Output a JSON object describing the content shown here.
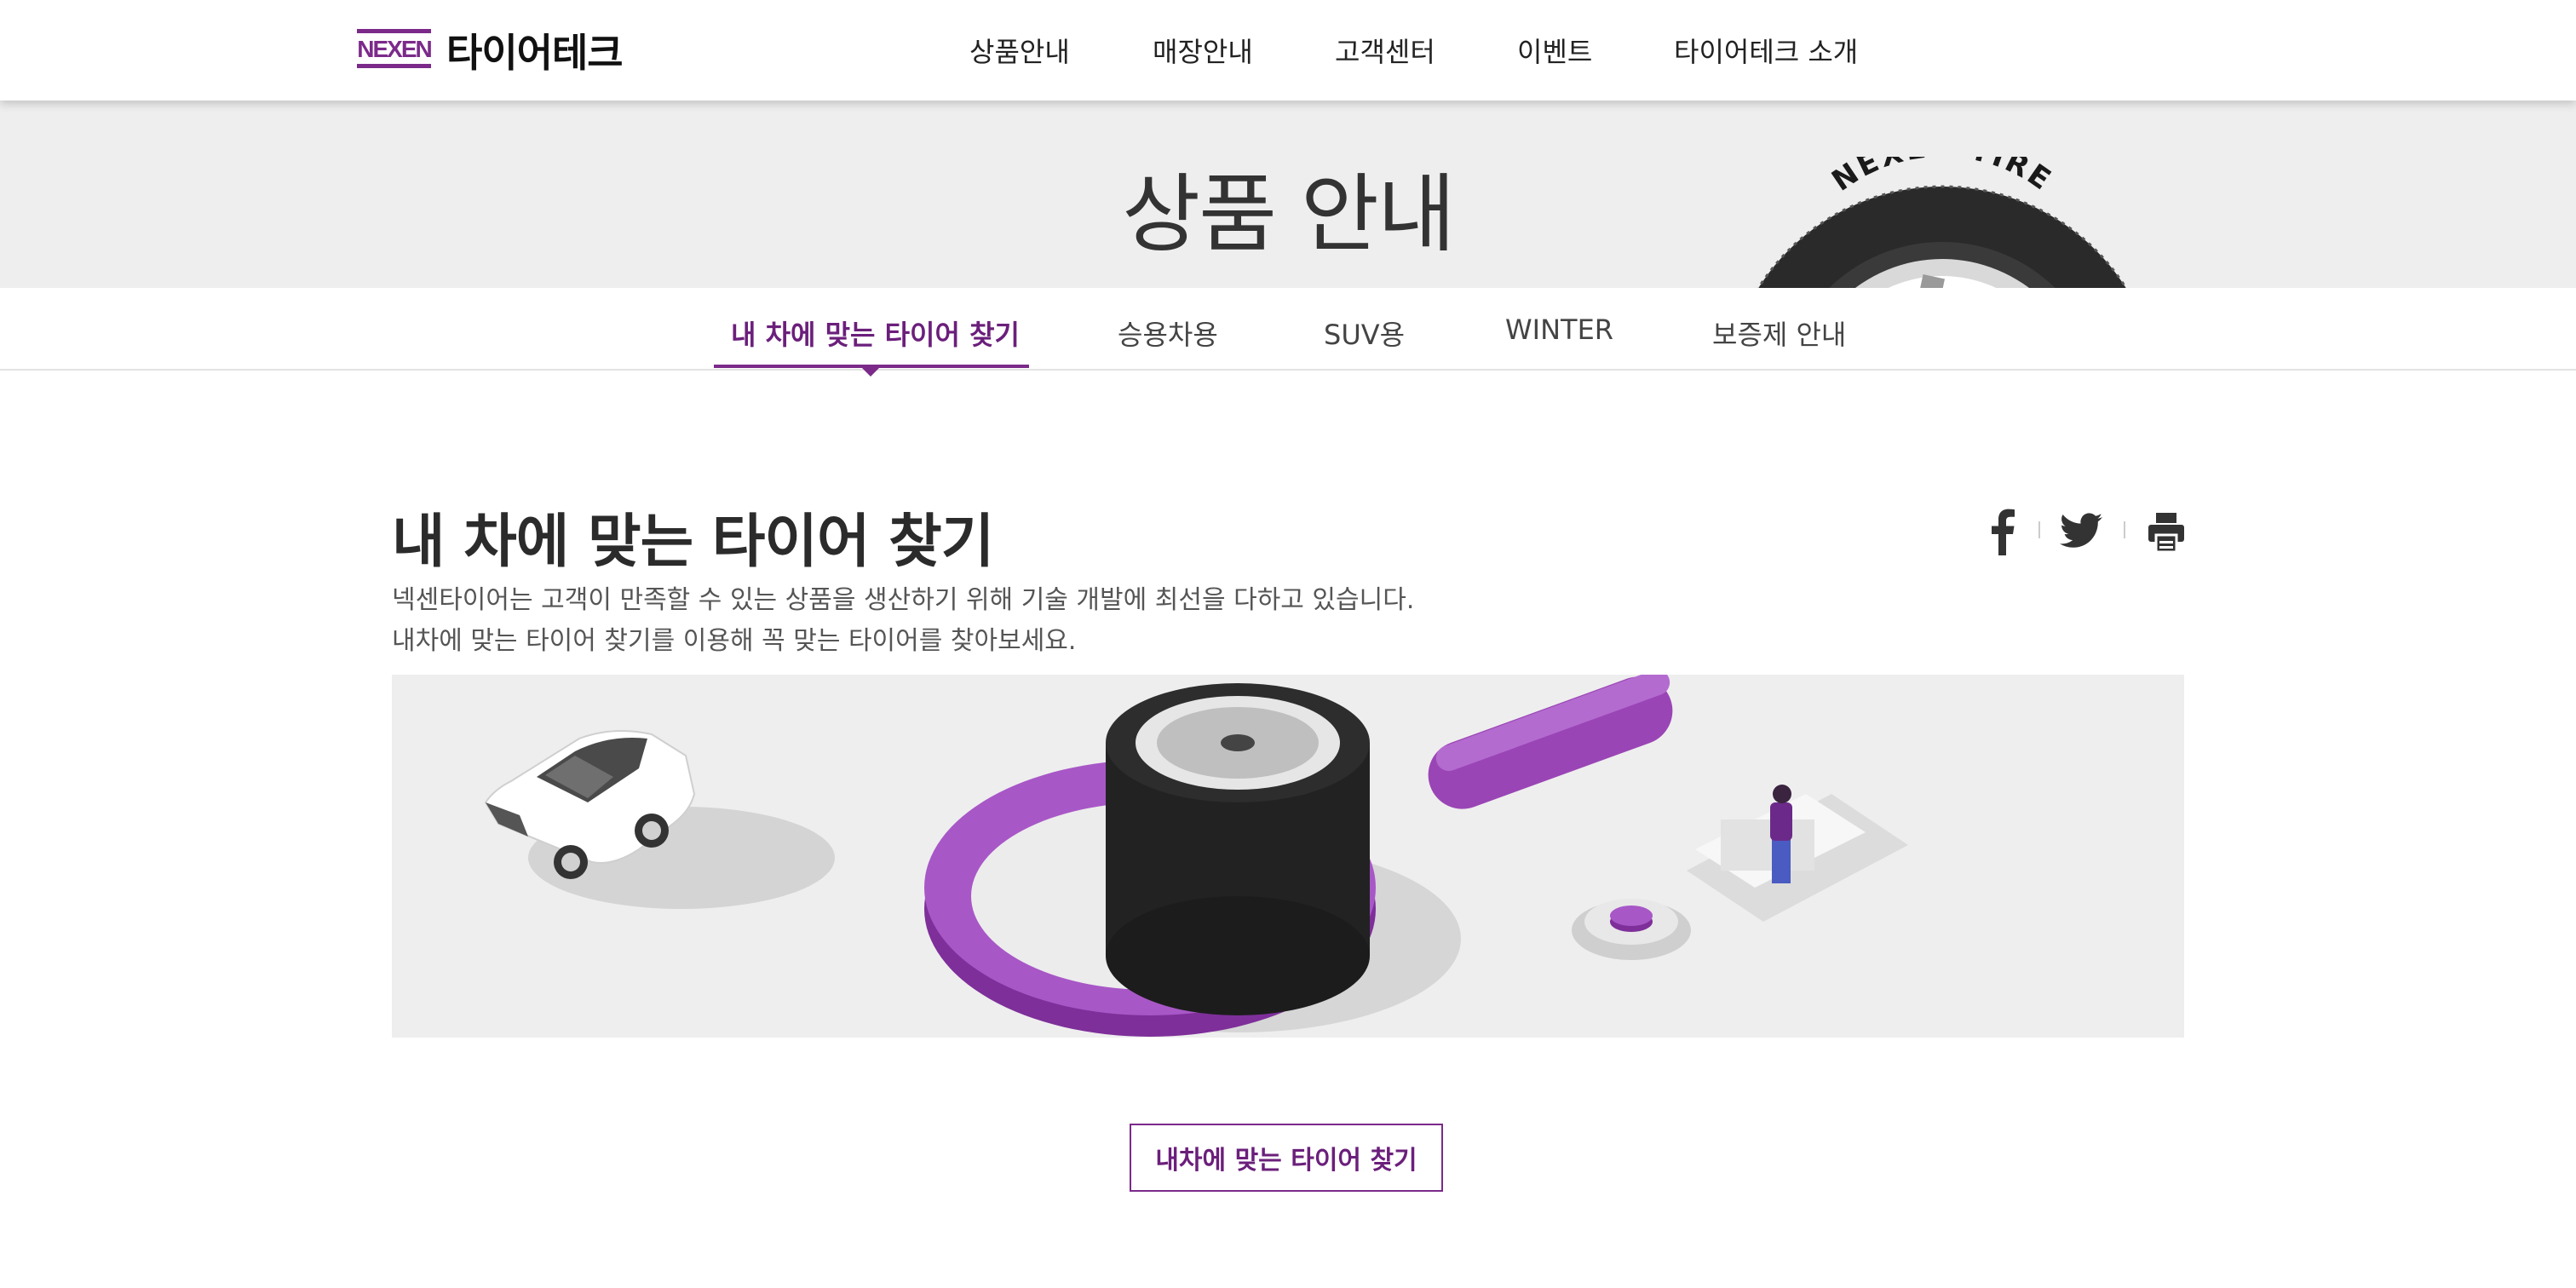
{
  "header": {
    "logo_badge": "NEXEN",
    "logo_text": "타이어테크",
    "nav": [
      "상품안내",
      "매장안내",
      "고객센터",
      "이벤트",
      "타이어테크 소개"
    ]
  },
  "hero": {
    "title": "상품 안내",
    "tire_text": "NEXEN TIRE"
  },
  "subnav": {
    "tabs": [
      "내 차에 맞는 타이어 찾기",
      "승용차용",
      "SUV용",
      "WINTER",
      "보증제 안내"
    ],
    "active_index": 0
  },
  "content": {
    "title": "내 차에 맞는 타이어 찾기",
    "desc_line1": "넥센타이어는 고객이 만족할 수 있는 상품을 생산하기 위해 기술 개발에 최선을 다하고 있습니다.",
    "desc_line2": "내차에 맞는 타이어 찾기를 이용해 꼭 맞는 타이어를 찾아보세요.",
    "share_icons": [
      "facebook-icon",
      "twitter-icon",
      "print-icon"
    ],
    "cta_label": "내차에 맞는 타이어 찾기"
  },
  "colors": {
    "accent": "#7b2a8a",
    "accent_text": "#6b1f7b",
    "hero_bg": "#eeeeee",
    "banner_bg": "#eeeeee"
  }
}
